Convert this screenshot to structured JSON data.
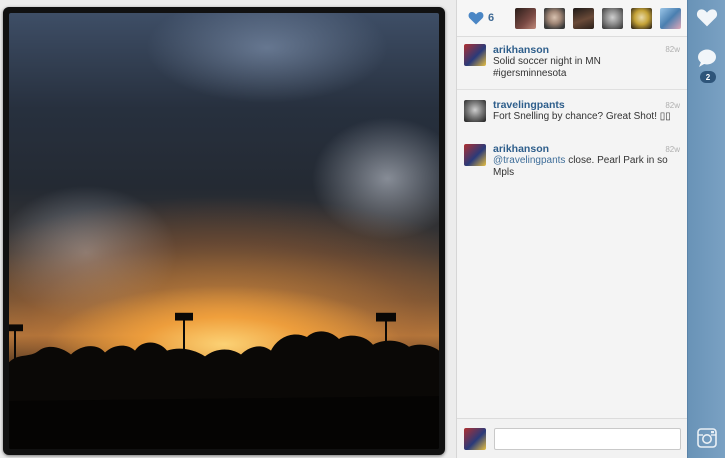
{
  "likes": {
    "count": "6",
    "likers": [
      {
        "name": "liker-1",
        "color": "#5a3a36"
      },
      {
        "name": "liker-2",
        "color": "#8d8076"
      },
      {
        "name": "liker-3",
        "color": "#3a2a24"
      },
      {
        "name": "liker-4",
        "color": "#7a7a7a"
      },
      {
        "name": "liker-5",
        "color": "#c4a236"
      },
      {
        "name": "liker-6",
        "color": "#4a7fb0"
      }
    ]
  },
  "caption": {
    "user": "arikhanson",
    "line1": "Solid soccer night in MN",
    "line2": "#igersminnesota",
    "time": "82w"
  },
  "comments": [
    {
      "user": "travelingpants",
      "text": "Fort Snelling by chance? Great Shot! ▯▯",
      "time": "82w"
    },
    {
      "user": "arikhanson",
      "mention": "@travelingpants",
      "text_after": " close. Pearl Park in so",
      "line2": "Mpls",
      "time": "82w"
    }
  ],
  "comment_input": {
    "value": "",
    "placeholder": ""
  },
  "rail": {
    "comment_count": "2"
  },
  "colors": {
    "accent": "#2e5e8b",
    "rail": "#7aa1c3",
    "heart": "#4a86c5"
  }
}
